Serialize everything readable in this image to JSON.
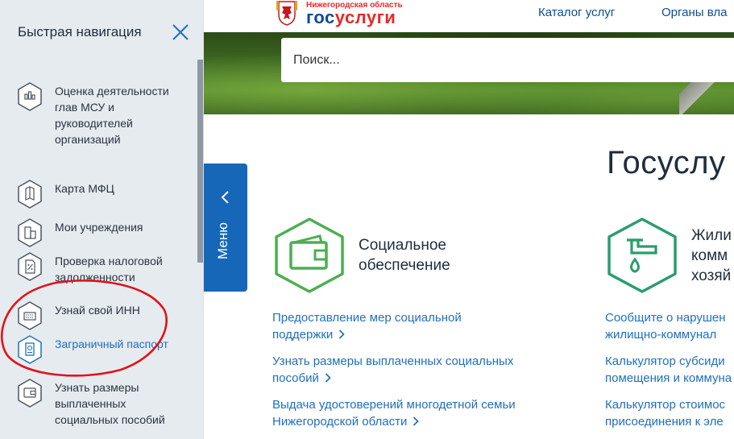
{
  "sidebar": {
    "title": "Быстрая навигация",
    "items": [
      {
        "label": "Оценка деятельности глав МСУ и руководителей организаций",
        "icon": "rating-icon"
      },
      {
        "label": "Карта МФЦ",
        "icon": "map-icon"
      },
      {
        "label": "Мои учреждения",
        "icon": "building-icon"
      },
      {
        "label": "Проверка налоговой задолженности",
        "icon": "tax-document-icon"
      },
      {
        "label": "Узнай свой ИНН",
        "icon": "id-card-icon"
      },
      {
        "label": "Заграничный паспорт",
        "icon": "passport-icon",
        "active": true
      },
      {
        "label": "Узнать размеры выплаченных социальных пособий",
        "icon": "wallet-icon"
      }
    ]
  },
  "header": {
    "logo_region": "Нижегородская область",
    "logo_brand_a": "гос",
    "logo_brand_b": "услуги",
    "nav": [
      "Каталог услуг",
      "Органы вла"
    ]
  },
  "search": {
    "placeholder": "Поиск..."
  },
  "menu_tab": {
    "label": "Меню"
  },
  "main": {
    "page_title": "Госуслу",
    "categories": [
      {
        "title_lines": [
          "Социальное",
          "обеспечение"
        ],
        "icon": "wallet-icon",
        "links": [
          [
            "Предоставление мер социальной",
            "поддержки"
          ],
          [
            "Узнать размеры выплаченных социальных",
            "пособий"
          ],
          [
            "Выдача удостоверений многодетной семьи",
            "Нижегородской области"
          ]
        ]
      },
      {
        "title_lines": [
          "Жили",
          "комм",
          "хозяй"
        ],
        "icon": "water-tap-icon",
        "links": [
          [
            "Сообщите о нарушен",
            "жилищно-коммунал"
          ],
          [
            "Калькулятор субсиди",
            "помещения и коммуна"
          ],
          [
            "Калькулятор стоимос",
            "присоединения к эле"
          ]
        ]
      }
    ]
  },
  "colors": {
    "accent_blue": "#1767b8",
    "link_blue": "#1f6fbe",
    "category_green": "#4caf50",
    "category_teal": "#2a9d6e",
    "annotation_red": "#e0131a",
    "sidebar_bg": "#e6ebf0"
  }
}
